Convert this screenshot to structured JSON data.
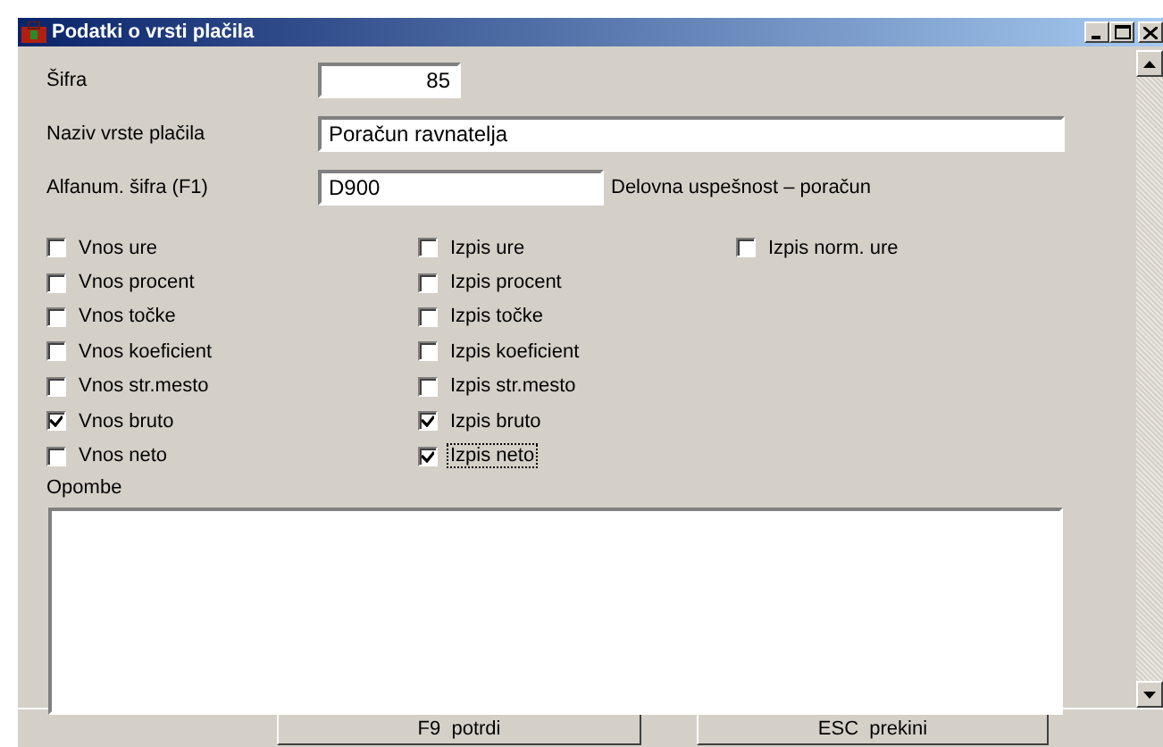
{
  "window": {
    "title": "Podatki o vrsti plačila"
  },
  "fields": [
    {
      "label": "Šifra",
      "value": "85",
      "kind": "number"
    },
    {
      "label": "Naziv vrste plačila",
      "value": "Poračun ravnatelja",
      "kind": "text"
    },
    {
      "label": "Alfanum. šifra (F1)",
      "value": "D900",
      "kind": "text",
      "note": "Delovna uspešnost – poračun"
    }
  ],
  "option_columns": [
    [
      {
        "label": "Vnos ure",
        "checked": false,
        "focused": false
      },
      {
        "label": "Vnos procent",
        "checked": false,
        "focused": false
      },
      {
        "label": "Vnos točke",
        "checked": false,
        "focused": false
      },
      {
        "label": "Vnos koeficient",
        "checked": false,
        "focused": false
      },
      {
        "label": "Vnos str.mesto",
        "checked": false,
        "focused": false
      },
      {
        "label": "Vnos bruto",
        "checked": true,
        "focused": false
      },
      {
        "label": "Vnos neto",
        "checked": false,
        "focused": false
      }
    ],
    [
      {
        "label": "Izpis ure",
        "checked": false,
        "focused": false
      },
      {
        "label": "Izpis procent",
        "checked": false,
        "focused": false
      },
      {
        "label": "Izpis točke",
        "checked": false,
        "focused": false
      },
      {
        "label": "Izpis koeficient",
        "checked": false,
        "focused": false
      },
      {
        "label": "Izpis str.mesto",
        "checked": false,
        "focused": false
      },
      {
        "label": "Izpis bruto",
        "checked": true,
        "focused": false
      },
      {
        "label": "Izpis neto",
        "checked": true,
        "focused": true
      }
    ],
    [
      {
        "label": "Izpis norm. ure",
        "checked": false,
        "focused": false
      }
    ]
  ],
  "notes": {
    "label": "Opombe"
  },
  "buttons": [
    "F9  potrdi",
    "ESC  prekini"
  ]
}
